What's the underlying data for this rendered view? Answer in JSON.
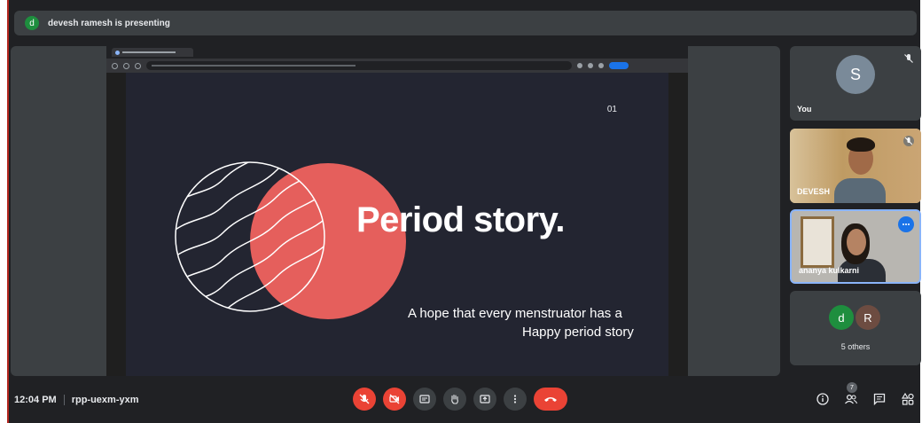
{
  "banner": {
    "presenter_initial": "d",
    "text": "devesh ramesh is presenting"
  },
  "slide": {
    "number": "01",
    "title": "Period story.",
    "subtitle_line1": "A hope that every menstruator has  a",
    "subtitle_line2": "Happy period story"
  },
  "participants": {
    "you": {
      "initial": "S",
      "name": "You",
      "muted": true
    },
    "p1": {
      "name": "DEVESH"
    },
    "p2": {
      "name": "ananya kulkarni"
    },
    "others": {
      "avatars": [
        "d",
        "R"
      ],
      "label": "5 others"
    }
  },
  "bottom_bar": {
    "time": "12:04 PM",
    "meeting_code": "rpp-uexm-yxm",
    "people_count": "7"
  },
  "colors": {
    "meet_bg": "#202124",
    "tile_bg": "#3c4043",
    "danger": "#ea4335",
    "accent_blue": "#1a73e8",
    "slide_bg": "#232531",
    "circle_coral": "#f0625f"
  },
  "icons": [
    "mic-off-icon",
    "camera-off-icon",
    "captions-icon",
    "raise-hand-icon",
    "present-icon",
    "more-options-icon",
    "end-call-icon",
    "info-icon",
    "people-icon",
    "chat-icon",
    "activities-icon"
  ]
}
